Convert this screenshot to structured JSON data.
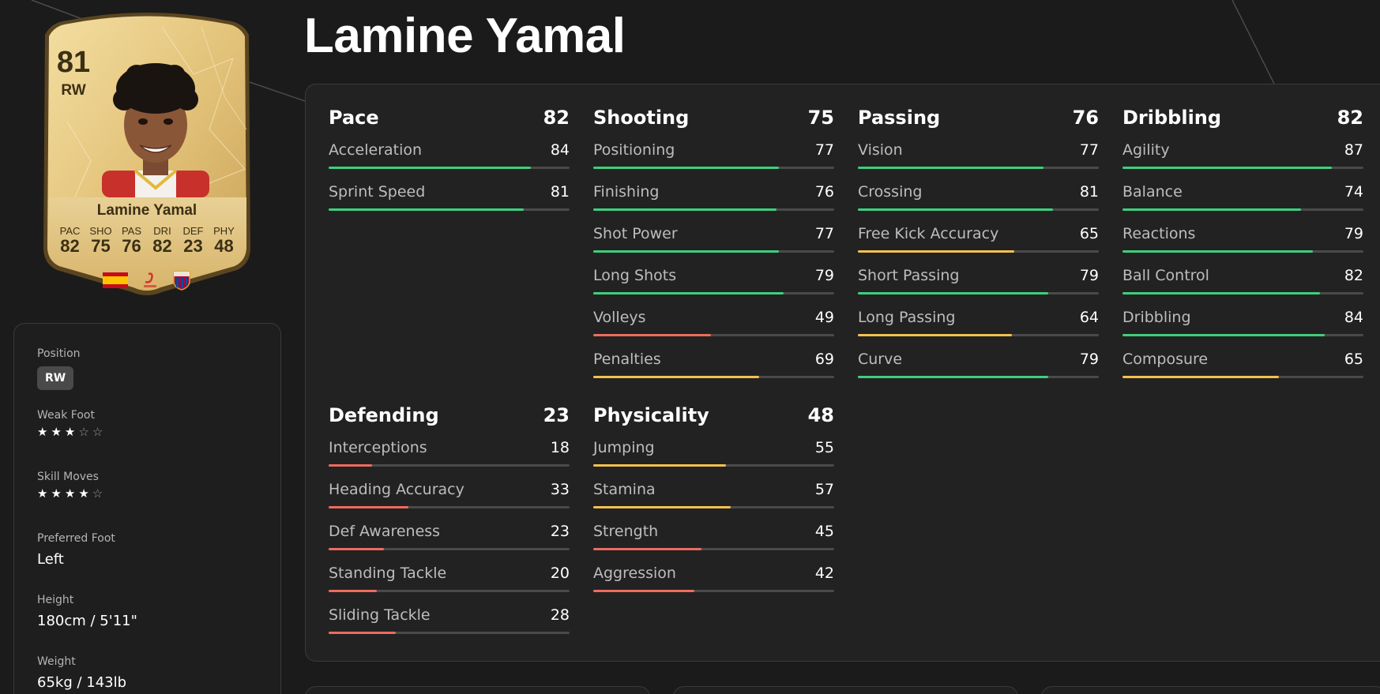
{
  "player": {
    "name": "Lamine Yamal",
    "card": {
      "rating": "81",
      "position": "RW",
      "name": "Lamine Yamal",
      "stats": [
        {
          "label": "PAC",
          "value": "82"
        },
        {
          "label": "SHO",
          "value": "75"
        },
        {
          "label": "PAS",
          "value": "76"
        },
        {
          "label": "DRI",
          "value": "82"
        },
        {
          "label": "DEF",
          "value": "23"
        },
        {
          "label": "PHY",
          "value": "48"
        }
      ],
      "badges": [
        "spain-flag-icon",
        "laliga-logo-icon",
        "barcelona-crest-icon"
      ]
    }
  },
  "info": {
    "position_label": "Position",
    "position_value": "RW",
    "weak_foot_label": "Weak Foot",
    "weak_foot_stars": 3,
    "skill_moves_label": "Skill Moves",
    "skill_moves_stars": 4,
    "max_stars": 5,
    "preferred_foot_label": "Preferred Foot",
    "preferred_foot_value": "Left",
    "height_label": "Height",
    "height_value": "180cm / 5'11\"",
    "weight_label": "Weight",
    "weight_value": "65kg / 143lb"
  },
  "colors": {
    "high": "#3ecf7d",
    "mid": "#f2c14e",
    "low": "#ee6b5f",
    "track": "#4a4a4a",
    "card_gold": "#e7c77c"
  },
  "groups": [
    {
      "name": "Pace",
      "value": "82",
      "stats": [
        {
          "name": "Acceleration",
          "value": 84
        },
        {
          "name": "Sprint Speed",
          "value": 81
        }
      ]
    },
    {
      "name": "Shooting",
      "value": "75",
      "stats": [
        {
          "name": "Positioning",
          "value": 77
        },
        {
          "name": "Finishing",
          "value": 76
        },
        {
          "name": "Shot Power",
          "value": 77
        },
        {
          "name": "Long Shots",
          "value": 79
        },
        {
          "name": "Volleys",
          "value": 49
        },
        {
          "name": "Penalties",
          "value": 69
        }
      ]
    },
    {
      "name": "Passing",
      "value": "76",
      "stats": [
        {
          "name": "Vision",
          "value": 77
        },
        {
          "name": "Crossing",
          "value": 81
        },
        {
          "name": "Free Kick Accuracy",
          "value": 65
        },
        {
          "name": "Short Passing",
          "value": 79
        },
        {
          "name": "Long Passing",
          "value": 64
        },
        {
          "name": "Curve",
          "value": 79
        }
      ]
    },
    {
      "name": "Dribbling",
      "value": "82",
      "stats": [
        {
          "name": "Agility",
          "value": 87
        },
        {
          "name": "Balance",
          "value": 74
        },
        {
          "name": "Reactions",
          "value": 79
        },
        {
          "name": "Ball Control",
          "value": 82
        },
        {
          "name": "Dribbling",
          "value": 84
        },
        {
          "name": "Composure",
          "value": 65
        }
      ]
    },
    {
      "name": "Defending",
      "value": "23",
      "stats": [
        {
          "name": "Interceptions",
          "value": 18
        },
        {
          "name": "Heading Accuracy",
          "value": 33
        },
        {
          "name": "Def Awareness",
          "value": 23
        },
        {
          "name": "Standing Tackle",
          "value": 20
        },
        {
          "name": "Sliding Tackle",
          "value": 28
        }
      ]
    },
    {
      "name": "Physicality",
      "value": "48",
      "stats": [
        {
          "name": "Jumping",
          "value": 55
        },
        {
          "name": "Stamina",
          "value": 57
        },
        {
          "name": "Strength",
          "value": 45
        },
        {
          "name": "Aggression",
          "value": 42
        }
      ]
    }
  ]
}
